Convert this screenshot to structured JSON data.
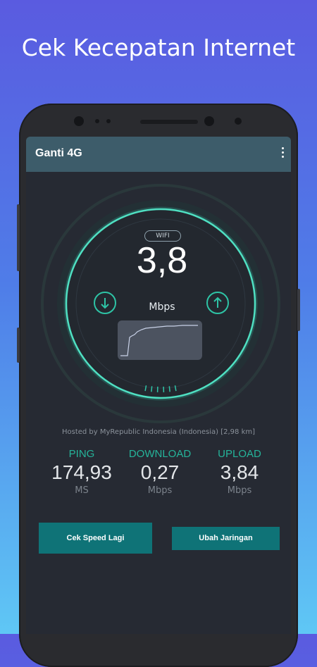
{
  "promo": {
    "headline": "Cek Kecepatan Internet"
  },
  "appbar": {
    "title": "Ganti 4G",
    "menu_icon": "more-vert-icon"
  },
  "gauge": {
    "network_type": "WIFI",
    "current_speed": "3,8",
    "unit": "Mbps",
    "download_icon": "arrow-down-circle-icon",
    "upload_icon": "arrow-up-circle-icon",
    "accent_color": "#2ec4a6"
  },
  "server": {
    "hosted_text": "Hosted by MyRepublic Indonesia (Indonesia) [2,98 km]"
  },
  "results": {
    "ping": {
      "label": "PING",
      "value": "174,93",
      "unit": "MS"
    },
    "download": {
      "label": "DOWNLOAD",
      "value": "0,27",
      "unit": "Mbps"
    },
    "upload": {
      "label": "UPLOAD",
      "value": "3,84",
      "unit": "Mbps"
    }
  },
  "actions": {
    "retest_label": "Cek Speed Lagi",
    "change_network_label": "Ubah Jaringan"
  },
  "colors": {
    "appbar": "#3d5c6a",
    "screen_bg": "#262a33",
    "button": "#0f7377",
    "label_teal": "#25b49a"
  }
}
